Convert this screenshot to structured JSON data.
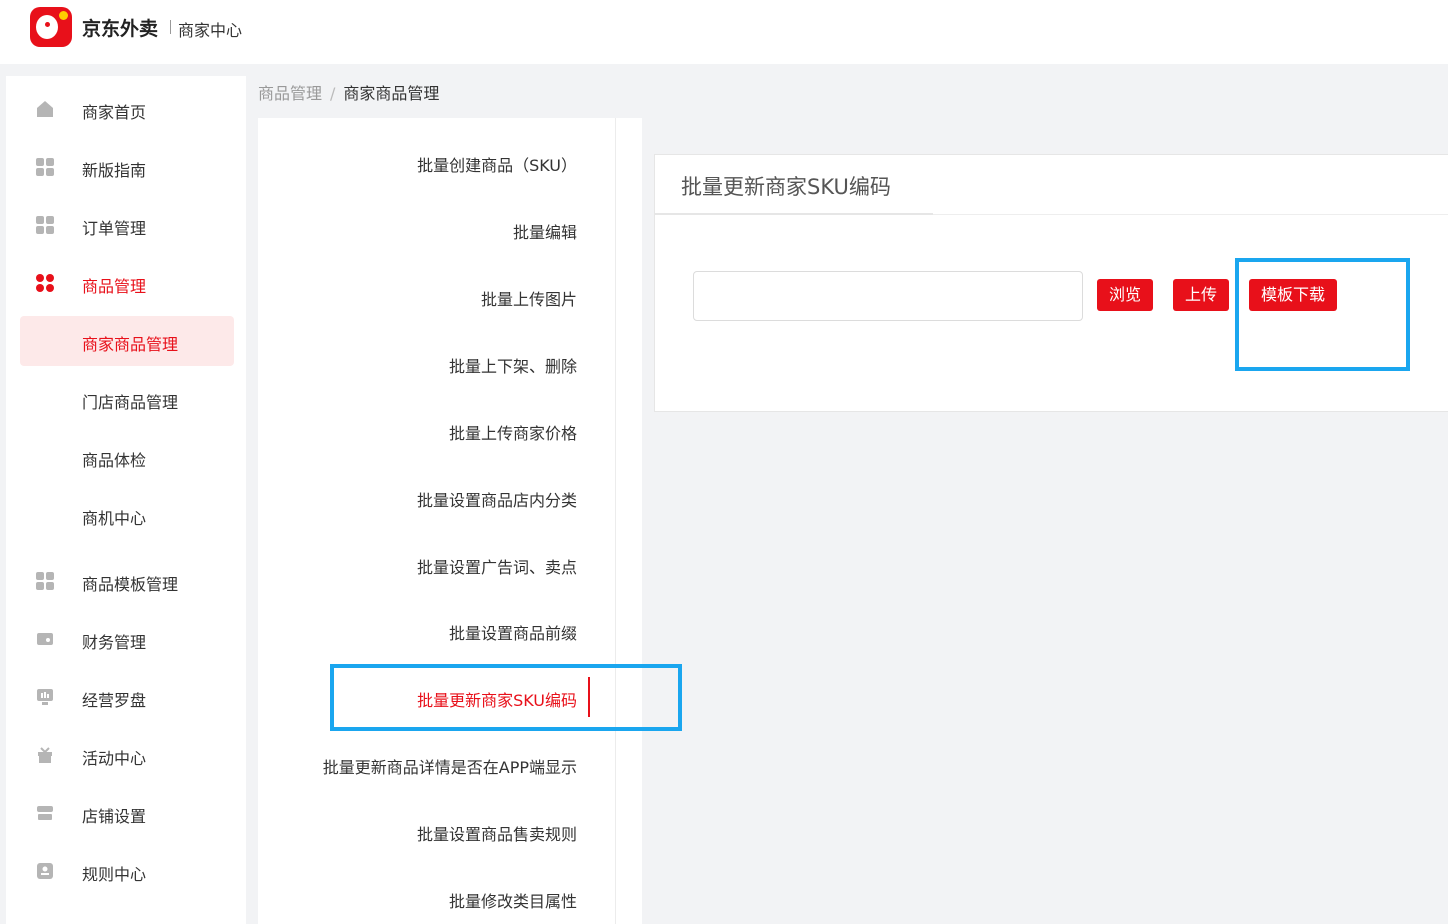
{
  "header": {
    "brand": "京东外卖",
    "subtitle": "商家中心"
  },
  "sidebar": {
    "items": [
      {
        "label": "商家首页",
        "icon": "home-icon"
      },
      {
        "label": "新版指南",
        "icon": "grid-icon"
      },
      {
        "label": "订单管理",
        "icon": "grid-icon"
      },
      {
        "label": "商品管理",
        "icon": "grid-icon",
        "active": true
      },
      {
        "label": "商家商品管理",
        "sub": true,
        "selected": true
      },
      {
        "label": "门店商品管理",
        "sub": true
      },
      {
        "label": "商品体检",
        "sub": true
      },
      {
        "label": "商机中心",
        "sub": true
      },
      {
        "label": "商品模板管理",
        "icon": "grid-icon"
      },
      {
        "label": "财务管理",
        "icon": "wallet-icon"
      },
      {
        "label": "经营罗盘",
        "icon": "monitor-icon"
      },
      {
        "label": "活动中心",
        "icon": "gift-icon"
      },
      {
        "label": "店铺设置",
        "icon": "store-icon"
      },
      {
        "label": "规则中心",
        "icon": "rule-icon"
      }
    ]
  },
  "breadcrumb": {
    "parent": "商品管理",
    "separator": "/",
    "current": "商家商品管理"
  },
  "submenu": {
    "items": [
      "批量创建商品（SKU）",
      "批量编辑",
      "批量上传图片",
      "批量上下架、删除",
      "批量上传商家价格",
      "批量设置商品店内分类",
      "批量设置广告词、卖点",
      "批量设置商品前缀",
      "批量更新商家SKU编码",
      "批量更新商品详情是否在APP端显示",
      "批量设置商品售卖规则",
      "批量修改类目属性"
    ],
    "active_index": 8
  },
  "panel": {
    "title": "批量更新商家SKU编码",
    "file_value": "",
    "browse_label": "浏览",
    "upload_label": "上传",
    "template_label": "模板下载"
  },
  "colors": {
    "brand_red": "#e8101a",
    "highlight_blue": "#1aa6ef"
  }
}
